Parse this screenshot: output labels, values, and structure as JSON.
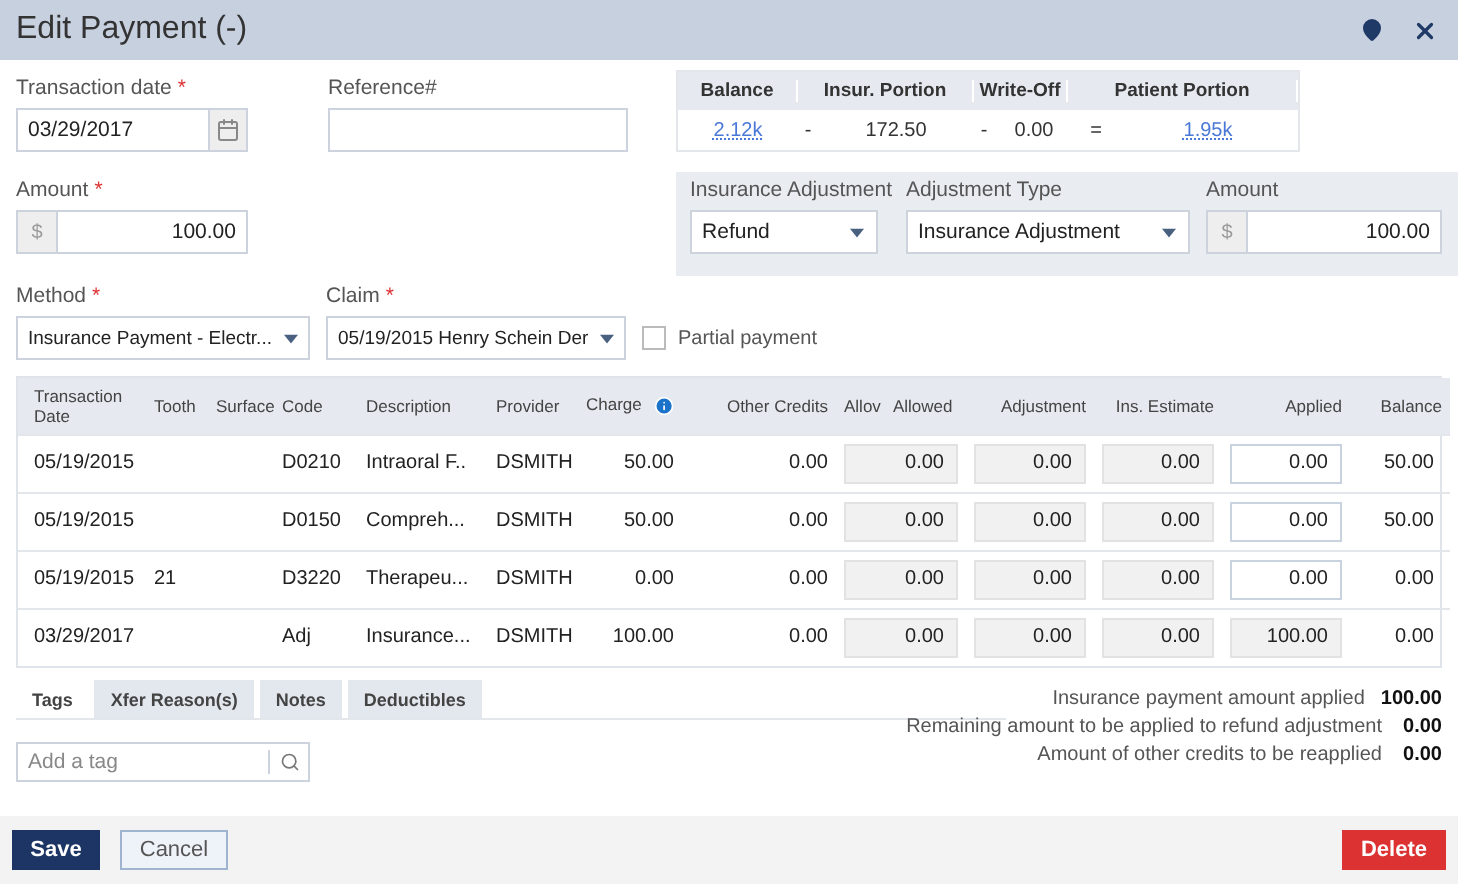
{
  "window": {
    "title": "Edit Payment (-)"
  },
  "transaction_date": {
    "label": "Transaction date",
    "required_mark": "*",
    "value": "03/29/2017"
  },
  "reference": {
    "label": "Reference#"
  },
  "amount": {
    "label": "Amount",
    "required_mark": "*",
    "currency": "$",
    "value": "100.00"
  },
  "summary": {
    "headers": [
      "Balance",
      "Insur. Portion",
      "Write-Off",
      "Patient Portion"
    ],
    "values": [
      {
        "kind": "link",
        "text": "2.12k"
      },
      {
        "kind": "operator",
        "text": "-"
      },
      {
        "kind": "value",
        "text": "172.50"
      },
      {
        "kind": "operator",
        "text": "-"
      },
      {
        "kind": "value",
        "text": "0.00"
      },
      {
        "kind": "operator",
        "text": "="
      },
      {
        "kind": "link",
        "text": "1.95k"
      }
    ]
  },
  "adjustment": {
    "insurance_adjustment": {
      "label": "Insurance Adjustment",
      "value": "Refund"
    },
    "adjustment_type": {
      "label": "Adjustment Type",
      "value": "Insurance Adjustment"
    },
    "amount": {
      "label": "Amount",
      "currency": "$",
      "value": "100.00"
    }
  },
  "method": {
    "label": "Method",
    "required_mark": "*",
    "value": "Insurance Payment - Electr..."
  },
  "claim": {
    "label": "Claim",
    "required_mark": "*",
    "value": "05/19/2015 Henry Schein Der"
  },
  "partial_payment": {
    "label": "Partial payment",
    "checked": false
  },
  "table": {
    "columns": [
      "Transaction Date",
      "Tooth",
      "Surface",
      "Code",
      "Description",
      "Provider",
      "Charge",
      "Other Credits",
      "Allov",
      "Allowed",
      "Adjustment",
      "Ins. Estimate",
      "Applied",
      "Balance"
    ],
    "rows": [
      {
        "date": "05/19/2015",
        "tooth": "",
        "surface": "",
        "code": "D0210",
        "description": "Intraoral F..",
        "provider": "DSMITH",
        "charge": "50.00",
        "other_credits": "0.00",
        "allowed": "0.00",
        "adjustment": "0.00",
        "ins_estimate": "0.00",
        "applied": {
          "value": "0.00",
          "disabled": false
        },
        "balance": "50.00"
      },
      {
        "date": "05/19/2015",
        "tooth": "",
        "surface": "",
        "code": "D0150",
        "description": "Compreh...",
        "provider": "DSMITH",
        "charge": "50.00",
        "other_credits": "0.00",
        "allowed": "0.00",
        "adjustment": "0.00",
        "ins_estimate": "0.00",
        "applied": {
          "value": "0.00",
          "disabled": false
        },
        "balance": "50.00"
      },
      {
        "date": "05/19/2015",
        "tooth": "21",
        "surface": "",
        "code": "D3220",
        "description": "Therapeu...",
        "provider": "DSMITH",
        "charge": "0.00",
        "other_credits": "0.00",
        "allowed": "0.00",
        "adjustment": "0.00",
        "ins_estimate": "0.00",
        "applied": {
          "value": "0.00",
          "disabled": false
        },
        "balance": "0.00"
      },
      {
        "date": "03/29/2017",
        "tooth": "",
        "surface": "",
        "code": "Adj",
        "description": "Insurance...",
        "provider": "DSMITH",
        "charge": "100.00",
        "other_credits": "0.00",
        "allowed": "0.00",
        "adjustment": "0.00",
        "ins_estimate": "0.00",
        "applied": {
          "value": "100.00",
          "disabled": true
        },
        "balance": "0.00"
      }
    ]
  },
  "tabs": [
    {
      "label": "Tags",
      "selected": true
    },
    {
      "label": "Xfer Reason(s)",
      "selected": false
    },
    {
      "label": "Notes",
      "selected": false
    },
    {
      "label": "Deductibles",
      "selected": false
    }
  ],
  "tag_search": {
    "placeholder": "Add a tag"
  },
  "totals": [
    {
      "label": "Insurance payment amount applied",
      "value": "100.00"
    },
    {
      "label": "Remaining amount to be applied to refund adjustment",
      "value": "0.00"
    },
    {
      "label": "Amount of other credits to be reapplied",
      "value": "0.00"
    }
  ],
  "buttons": {
    "save": "Save",
    "cancel": "Cancel",
    "delete": "Delete"
  }
}
